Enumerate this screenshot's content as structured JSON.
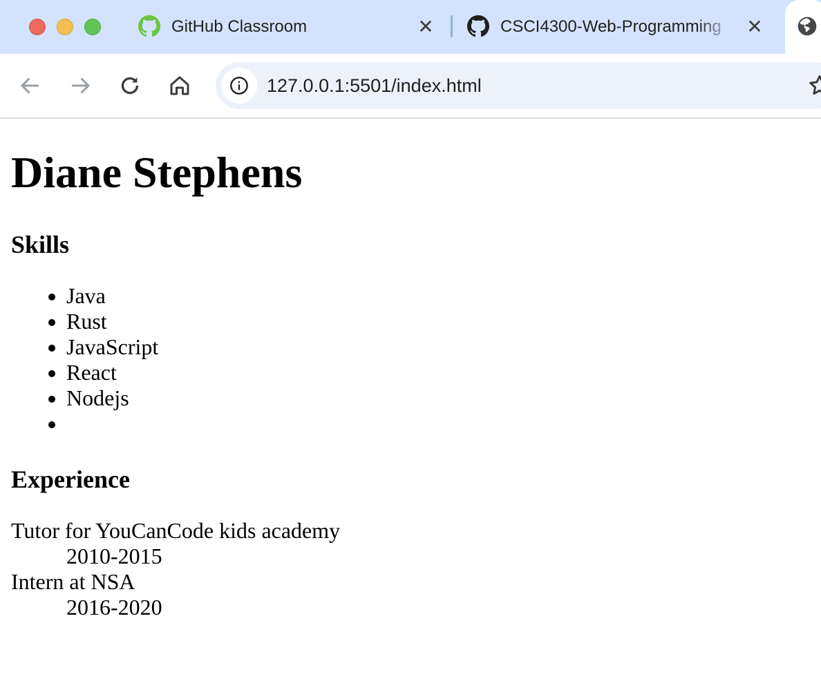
{
  "browser": {
    "tabs": [
      {
        "title": "GitHub Classroom",
        "favicon": "github-icon-green"
      },
      {
        "title": "CSCI4300-Web-Programming",
        "favicon": "github-icon-black"
      },
      {
        "title": "",
        "favicon": "globe-icon"
      }
    ],
    "close_glyph": "✕",
    "address": "127.0.0.1:5501/index.html"
  },
  "page": {
    "heading": "Diane Stephens",
    "skills_heading": "Skills",
    "skills": [
      "Java",
      "Rust",
      "JavaScript",
      "React",
      "Nodejs",
      ""
    ],
    "experience_heading": "Experience",
    "experience": [
      {
        "role": "Tutor for YouCanCode kids academy",
        "years": "2010-2015"
      },
      {
        "role": "Intern at NSA",
        "years": "2016-2020"
      }
    ]
  },
  "colors": {
    "tabstrip": "#d3e3fd",
    "omnibox": "#edf2fa",
    "github_green": "#6cc644"
  }
}
